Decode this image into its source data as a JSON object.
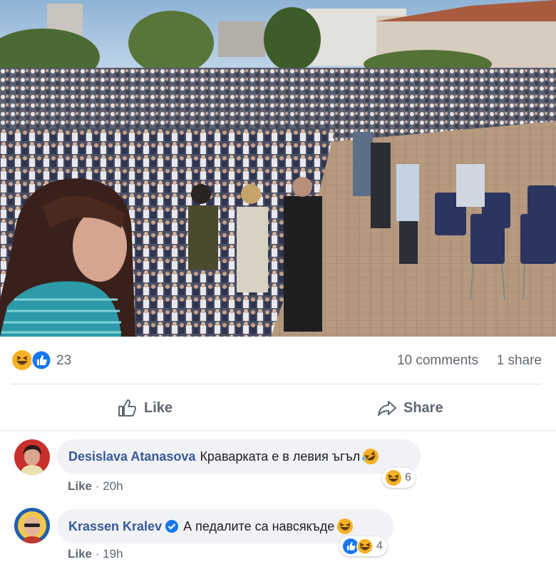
{
  "post": {
    "reaction_icons": [
      "haha-icon",
      "like-icon"
    ],
    "reaction_count": "23",
    "comments_count": "10 comments",
    "shares_count": "1 share"
  },
  "actions": {
    "like_label": "Like",
    "share_label": "Share"
  },
  "comments": [
    {
      "author": "Desislava Atanasova",
      "text": "Краварката е в левия ъгъл",
      "inline_emoji": "rofl-icon",
      "like_label": "Like",
      "separator": "·",
      "time": "20h",
      "reaction_icons": [
        "haha-icon"
      ],
      "reaction_count": "6"
    },
    {
      "author": "Krassen Kralev",
      "verified": true,
      "text": "А педалите са навсякъде",
      "inline_emoji": "haha-icon",
      "like_label": "Like",
      "separator": "·",
      "time": "19h",
      "reaction_icons": [
        "like-icon",
        "haha-icon"
      ],
      "reaction_count": "4"
    }
  ],
  "colors": {
    "author_link": "#385898",
    "meta_text": "#606770",
    "bubble_bg": "#f0f2f5",
    "like_blue": "#1877f2",
    "haha_yellow": "#f7b125"
  }
}
